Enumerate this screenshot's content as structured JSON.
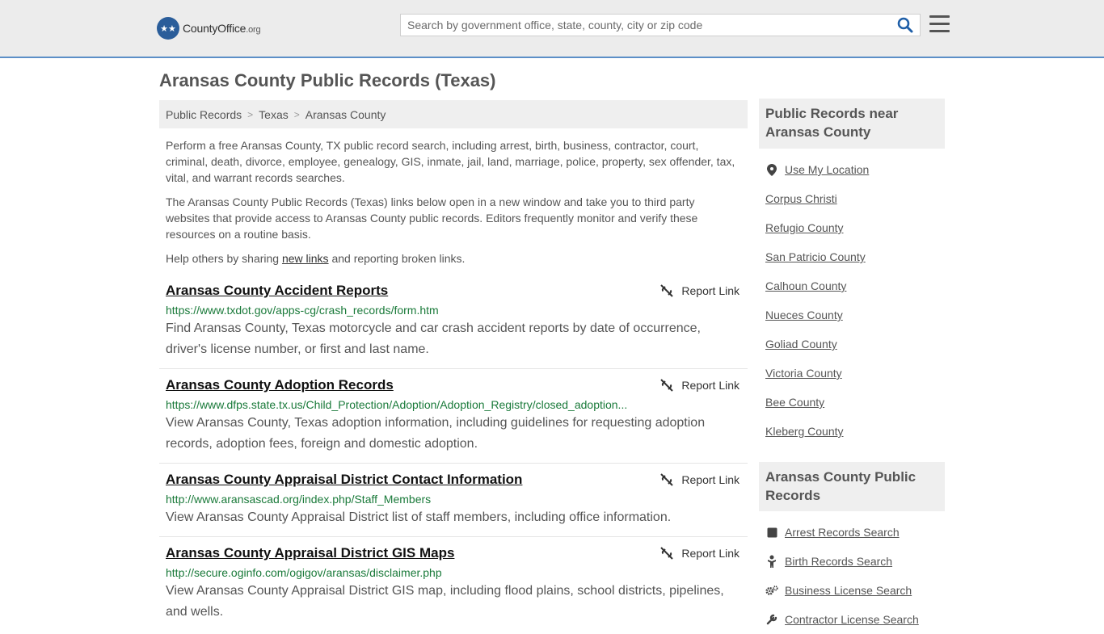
{
  "header": {
    "logo_text": "CountyOffice",
    "logo_tld": ".org",
    "search_placeholder": "Search by government office, state, county, city or zip code"
  },
  "page": {
    "title": "Aransas County Public Records (Texas)",
    "breadcrumb": [
      "Public Records",
      "Texas",
      "Aransas County"
    ],
    "intro1": "Perform a free Aransas County, TX public record search, including arrest, birth, business, contractor, court, criminal, death, divorce, employee, genealogy, GIS, inmate, jail, land, marriage, police, property, sex offender, tax, vital, and warrant records searches.",
    "intro2": "The Aransas County Public Records (Texas) links below open in a new window and take you to third party websites that provide access to Aransas County public records. Editors frequently monitor and verify these resources on a routine basis.",
    "help_prefix": "Help others by sharing ",
    "help_link": "new links",
    "help_suffix": " and reporting broken links."
  },
  "records": [
    {
      "title": "Aransas County Accident Reports",
      "url": "https://www.txdot.gov/apps-cg/crash_records/form.htm",
      "desc": "Find Aransas County, Texas motorcycle and car crash accident reports by date of occurrence, driver's license number, or first and last name.",
      "report": "Report Link"
    },
    {
      "title": "Aransas County Adoption Records",
      "url": "https://www.dfps.state.tx.us/Child_Protection/Adoption/Adoption_Registry/closed_adoption...",
      "desc": "View Aransas County, Texas adoption information, including guidelines for requesting adoption records, adoption fees, foreign and domestic adoption.",
      "report": "Report Link"
    },
    {
      "title": "Aransas County Appraisal District Contact Information",
      "url": "http://www.aransascad.org/index.php/Staff_Members",
      "desc": "View Aransas County Appraisal District list of staff members, including office information.",
      "report": "Report Link"
    },
    {
      "title": "Aransas County Appraisal District GIS Maps",
      "url": "http://secure.oginfo.com/ogigov/aransas/disclaimer.php",
      "desc": "View Aransas County Appraisal District GIS map, including flood plains, school districts, pipelines, and wells.",
      "report": "Report Link"
    }
  ],
  "sidebar": {
    "nearby_title": "Public Records near Aransas County",
    "use_location": "Use My Location",
    "nearby": [
      "Corpus Christi",
      "Refugio County",
      "San Patricio County",
      "Calhoun County",
      "Nueces County",
      "Goliad County",
      "Victoria County",
      "Bee County",
      "Kleberg County"
    ],
    "records_title": "Aransas County Public Records",
    "record_links": [
      {
        "label": "Arrest Records Search",
        "icon": "square-icon"
      },
      {
        "label": "Birth Records Search",
        "icon": "baby-icon"
      },
      {
        "label": "Business License Search",
        "icon": "gears-icon"
      },
      {
        "label": "Contractor License Search",
        "icon": "tools-icon"
      }
    ]
  }
}
